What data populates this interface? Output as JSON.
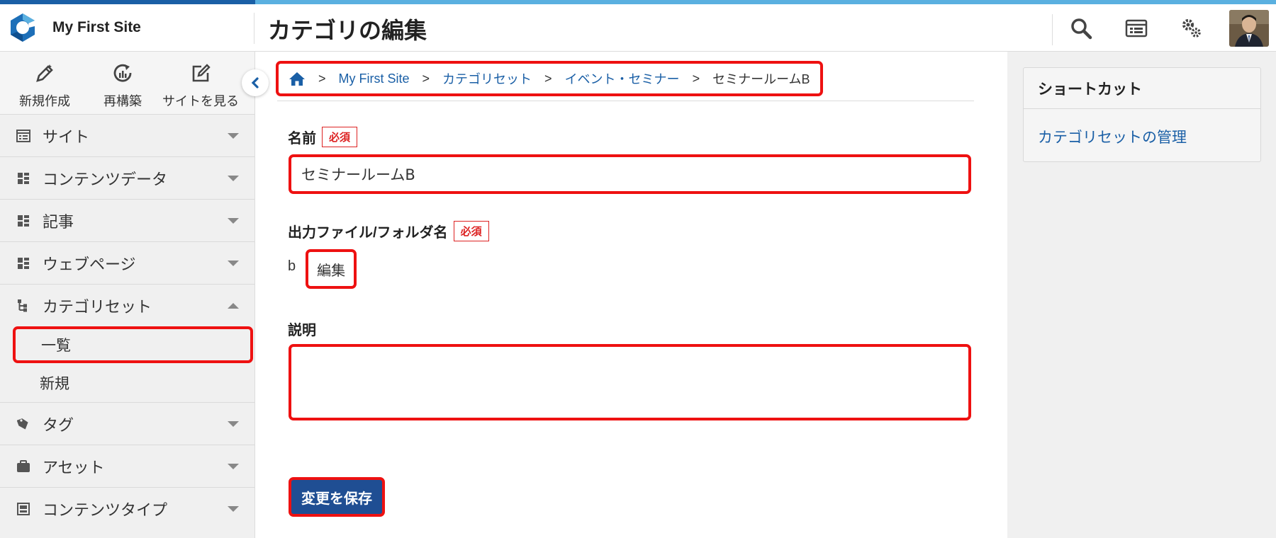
{
  "header": {
    "site_name": "My First Site",
    "page_title": "カテゴリの編集"
  },
  "sidebar": {
    "quick_actions": [
      {
        "label": "新規作成",
        "icon": "pencil-icon"
      },
      {
        "label": "再構築",
        "icon": "rebuild-icon"
      },
      {
        "label": "サイトを見る",
        "icon": "external-link-icon"
      }
    ],
    "menu": [
      {
        "label": "サイト",
        "icon": "site-icon",
        "expanded": false
      },
      {
        "label": "コンテンツデータ",
        "icon": "content-data-icon",
        "expanded": false
      },
      {
        "label": "記事",
        "icon": "entry-icon",
        "expanded": false
      },
      {
        "label": "ウェブページ",
        "icon": "page-icon",
        "expanded": false
      },
      {
        "label": "カテゴリセット",
        "icon": "category-set-icon",
        "expanded": true
      },
      {
        "label": "タグ",
        "icon": "tag-icon",
        "expanded": false
      },
      {
        "label": "アセット",
        "icon": "asset-icon",
        "expanded": false
      },
      {
        "label": "コンテンツタイプ",
        "icon": "content-type-icon",
        "expanded": false
      }
    ],
    "submenu": [
      {
        "label": "一覧",
        "active": true
      },
      {
        "label": "新規",
        "active": false
      }
    ]
  },
  "breadcrumb": {
    "items": [
      "My First Site",
      "カテゴリセット",
      "イベント・セミナー"
    ],
    "current": "セミナールームB",
    "separator": ">"
  },
  "form": {
    "name_label": "名前",
    "required": "必須",
    "name_value": "セミナールームB",
    "basename_label": "出力ファイル/フォルダ名",
    "basename_value": "b",
    "edit_label": "編集",
    "description_label": "説明",
    "description_value": "",
    "save_label": "変更を保存"
  },
  "shortcuts": {
    "title": "ショートカット",
    "link": "カテゴリセットの管理"
  },
  "colors": {
    "accent": "#1a5fa6",
    "highlight": "#ee1111",
    "save_button": "#1f4e93",
    "required": "#dd2222"
  }
}
